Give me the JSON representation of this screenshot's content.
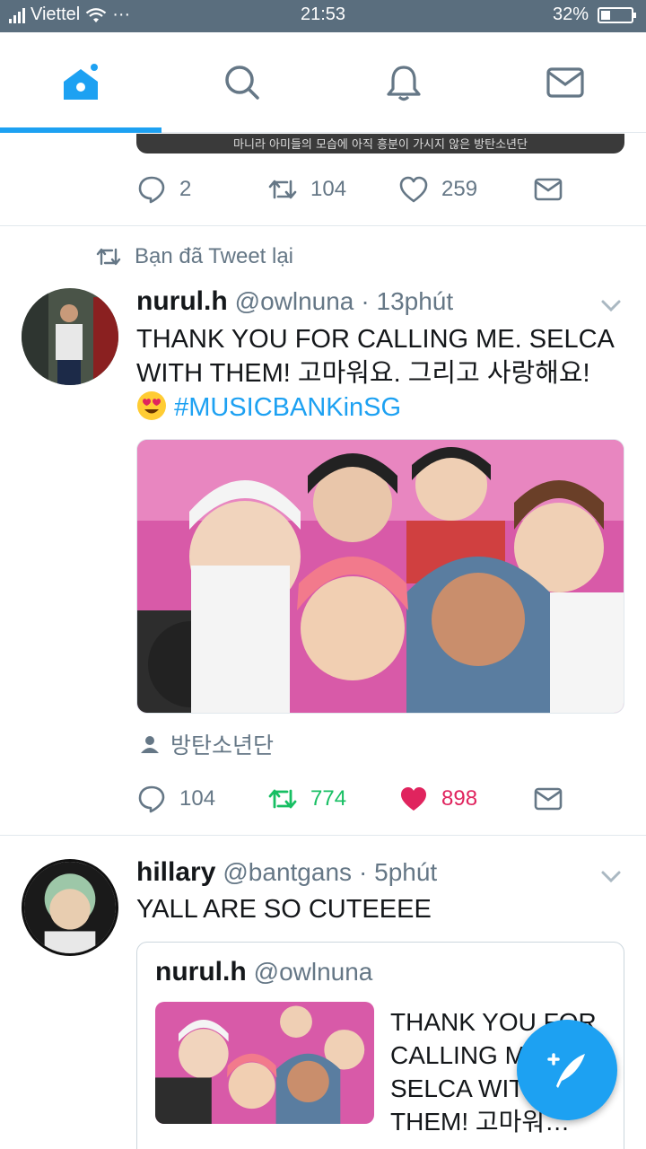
{
  "status_bar": {
    "carrier": "Viettel",
    "dots": "···",
    "time": "21:53",
    "battery_percent": "32%",
    "battery_level": 0.32
  },
  "nav": {
    "tabs": [
      {
        "name": "home",
        "icon": "home-icon",
        "active": true
      },
      {
        "name": "search",
        "icon": "search-icon",
        "active": false
      },
      {
        "name": "notifications",
        "icon": "bell-icon",
        "active": false
      },
      {
        "name": "messages",
        "icon": "mail-icon",
        "active": false
      }
    ]
  },
  "tweet0": {
    "media_caption": "마니라 아미들의 모습에 아직 흥분이 가시지 않은 방탄소년단",
    "reply_count": "2",
    "retweet_count": "104",
    "like_count": "259"
  },
  "tweet1": {
    "retweet_context": "Bạn đã Tweet lại",
    "name": "nurul.h",
    "handle": "@owlnuna",
    "time": "· 13phút",
    "text": "THANK YOU FOR CALLING ME. SELCA WITH THEM! 고마워요. 그리고 사랑해요!",
    "hashtag": "#MUSICBANKinSG",
    "tagged_user": "방탄소년단",
    "reply_count": "104",
    "retweet_count": "774",
    "like_count": "898",
    "retweeted": true,
    "liked": true
  },
  "tweet2": {
    "name": "hillary",
    "handle": "@bantgans",
    "time": "· 5phút",
    "text": "YALL ARE SO CUTEEEE",
    "quote": {
      "name": "nurul.h",
      "handle": "@owlnuna",
      "text": "THANK YOU FOR CALLING ME. SELCA WITH THEM! 고마워…"
    }
  },
  "colors": {
    "accent": "#1da1f2",
    "retweet_green": "#17bf63",
    "like_red": "#e0245e",
    "muted": "#657786",
    "status_bar": "#5a6e7e"
  }
}
